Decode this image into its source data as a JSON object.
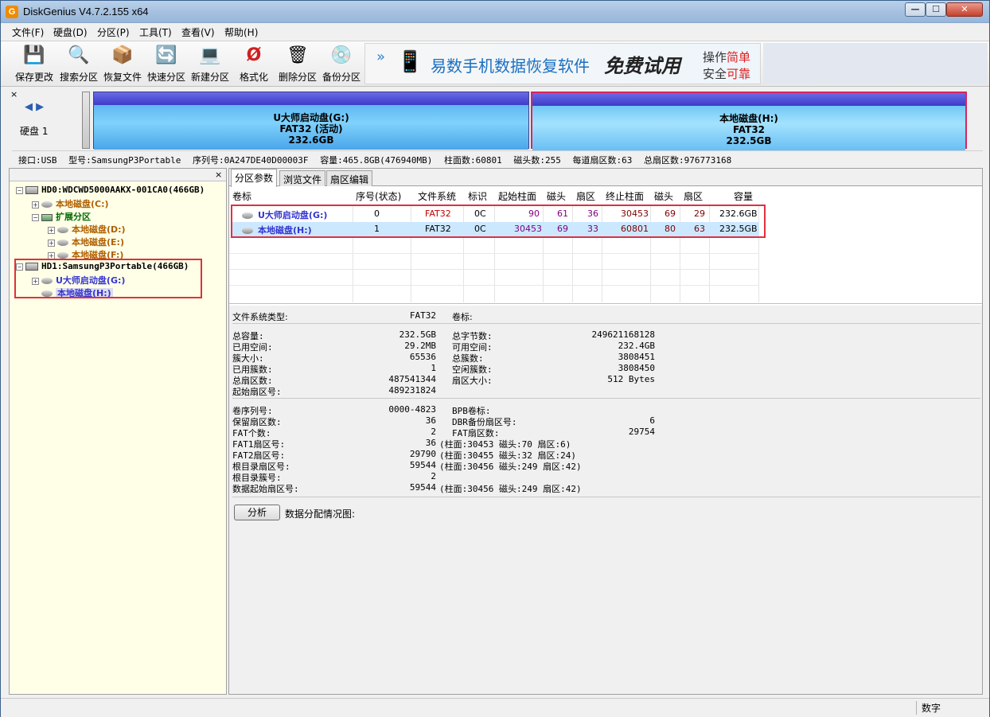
{
  "window": {
    "title": "DiskGenius V4.7.2.155 x64",
    "app_icon_glyph": "G",
    "controls": {
      "minimize": "—",
      "maximize": "☐",
      "close": "✕"
    }
  },
  "menu": [
    {
      "label": "文件(F)"
    },
    {
      "label": "硬盘(D)"
    },
    {
      "label": "分区(P)"
    },
    {
      "label": "工具(T)"
    },
    {
      "label": "查看(V)"
    },
    {
      "label": "帮助(H)"
    }
  ],
  "toolbar": [
    {
      "label": "保存更改",
      "icon": "save-icon",
      "glyph": "💾"
    },
    {
      "label": "搜索分区",
      "icon": "search-icon",
      "glyph": "🔍"
    },
    {
      "label": "恢复文件",
      "icon": "recover-icon",
      "glyph": "📦"
    },
    {
      "label": "快速分区",
      "icon": "quick-partition-icon",
      "glyph": "🔄"
    },
    {
      "label": "新建分区",
      "icon": "new-partition-icon",
      "glyph": "💻"
    },
    {
      "label": "格式化",
      "icon": "format-icon",
      "glyph": "Ø"
    },
    {
      "label": "删除分区",
      "icon": "delete-icon",
      "glyph": "🗑"
    },
    {
      "label": "备份分区",
      "icon": "backup-icon",
      "glyph": "💿"
    }
  ],
  "banner": {
    "main": "易数手机数据恢复软件",
    "free": "免费试用",
    "line1_a": "操作",
    "line1_b": "简单",
    "line2_a": "安全",
    "line2_b": "可靠"
  },
  "diskmap": {
    "close": "×",
    "arrows": "◀ ▶",
    "disk_label": "硬盘 1",
    "partitions": [
      {
        "name": "U大师启动盘(G:)",
        "fs": "FAT32 (活动)",
        "size": "232.6GB"
      },
      {
        "name": "本地磁盘(H:)",
        "fs": "FAT32",
        "size": "232.5GB"
      }
    ]
  },
  "disk_info": [
    "接口:USB",
    "型号:SamsungP3Portable",
    "序列号:0A247DE40D00003F",
    "容量:465.8GB(476940MB)",
    "柱面数:60801",
    "磁头数:255",
    "每道扇区数:63",
    "总扇区数:976773168"
  ],
  "tree": {
    "close": "×",
    "nodes": [
      {
        "label": "HD0:WDCWD5000AAKX-001CA0(466GB)"
      },
      {
        "label": "本地磁盘(C:)"
      },
      {
        "label": "扩展分区"
      },
      {
        "label": "本地磁盘(D:)"
      },
      {
        "label": "本地磁盘(E:)"
      },
      {
        "label": "本地磁盘(F:)"
      },
      {
        "label": "HD1:SamsungP3Portable(466GB)"
      },
      {
        "label": "U大师启动盘(G:)"
      },
      {
        "label": "本地磁盘(H:)"
      }
    ]
  },
  "tabs": [
    {
      "label": "分区参数"
    },
    {
      "label": "浏览文件"
    },
    {
      "label": "扇区编辑"
    }
  ],
  "ptable": {
    "headers": [
      "卷标",
      "序号(状态)",
      "文件系统",
      "标识",
      "起始柱面",
      "磁头",
      "扇区",
      "终止柱面",
      "磁头",
      "扇区",
      "容量"
    ],
    "rows": [
      [
        "U大师启动盘(G:)",
        "0",
        "FAT32",
        "0C",
        "90",
        "61",
        "36",
        "30453",
        "69",
        "29",
        "232.6GB"
      ],
      [
        "本地磁盘(H:)",
        "1",
        "FAT32",
        "0C",
        "30453",
        "69",
        "33",
        "60801",
        "80",
        "63",
        "232.5GB"
      ]
    ]
  },
  "details": {
    "fs_type_label": "文件系统类型:",
    "fs_type": "FAT32",
    "vol_label_label": "卷标:",
    "left1": [
      {
        "k": "总容量:",
        "v": "232.5GB"
      },
      {
        "k": "已用空间:",
        "v": "29.2MB"
      },
      {
        "k": "簇大小:",
        "v": "65536"
      },
      {
        "k": "已用簇数:",
        "v": "1"
      },
      {
        "k": "总扇区数:",
        "v": "487541344"
      },
      {
        "k": "起始扇区号:",
        "v": "489231824"
      }
    ],
    "right1": [
      {
        "k": "总字节数:",
        "v": "249621168128"
      },
      {
        "k": "可用空间:",
        "v": "232.4GB"
      },
      {
        "k": "总簇数:",
        "v": "3808451"
      },
      {
        "k": "空闲簇数:",
        "v": "3808450"
      },
      {
        "k": "扇区大小:",
        "v": "512 Bytes"
      }
    ],
    "left2": [
      {
        "k": "卷序列号:",
        "v": "0000-4823"
      },
      {
        "k": "保留扇区数:",
        "v": "36"
      },
      {
        "k": "FAT个数:",
        "v": "2"
      },
      {
        "k": "FAT1扇区号:",
        "v": "36"
      },
      {
        "k": "FAT2扇区号:",
        "v": "29790"
      },
      {
        "k": "根目录扇区号:",
        "v": "59544"
      },
      {
        "k": "根目录簇号:",
        "v": "2"
      },
      {
        "k": "数据起始扇区号:",
        "v": "59544"
      }
    ],
    "left2_extra": [
      "",
      "",
      "",
      "(柱面:30453 磁头:70 扇区:6)",
      "(柱面:30455 磁头:32 扇区:24)",
      "(柱面:30456 磁头:249 扇区:42)",
      "",
      "(柱面:30456 磁头:249 扇区:42)"
    ],
    "right2": [
      {
        "k": "BPB卷标:",
        "v": ""
      },
      {
        "k": "DBR备份扇区号:",
        "v": "6"
      },
      {
        "k": "FAT扇区数:",
        "v": "29754"
      }
    ],
    "analyze_btn": "分析",
    "analyze_label": "数据分配情况图:"
  },
  "status": {
    "num": "数字"
  },
  "colors": {
    "accent_red": "#e03040",
    "partition_blue": "#5fb7f2",
    "tree_bg": "#ffffe8"
  }
}
